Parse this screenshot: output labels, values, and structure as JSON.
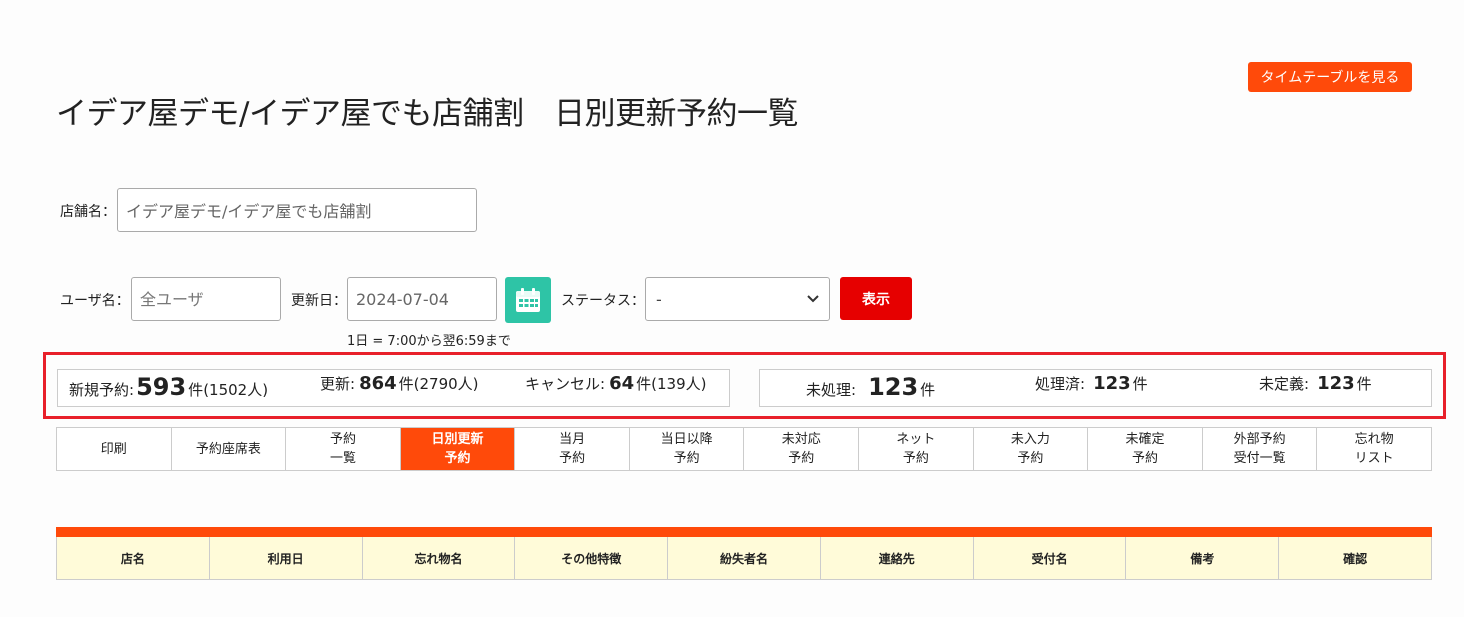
{
  "header": {
    "timetable_button": "タイムテーブルを見る",
    "title": "イデア屋デモ/イデア屋でも店舗割　日別更新予約一覧"
  },
  "filters": {
    "store_label": "店舗名：",
    "store_value": "イデア屋デモ/イデア屋でも店舗割",
    "user_label": "ユーザ名：",
    "user_placeholder": "全ユーザ",
    "date_label": "更新日：",
    "date_value": "2024-07-04",
    "status_label": "ステータス：",
    "status_selected": "-",
    "show_button": "表示",
    "date_hint": "1日 = 7:00から翌6:59まで"
  },
  "stats": {
    "new_label": "新規予約:",
    "new_count": "593",
    "new_unit": "件",
    "new_people": "(1502人)",
    "update_label": "更新:",
    "update_count": "864",
    "update_unit": "件",
    "update_people": "(2790人)",
    "cancel_label": "キャンセル:",
    "cancel_count": "64",
    "cancel_unit": "件",
    "cancel_people": "(139人)",
    "unprocessed_label": "未処理:",
    "unprocessed_count": "123",
    "unprocessed_unit": "件",
    "processed_label": "処理済:",
    "processed_count": "123",
    "processed_unit": "件",
    "undefined_label": "未定義:",
    "undefined_count": "123",
    "undefined_unit": "件"
  },
  "tabs": [
    {
      "label": "印刷"
    },
    {
      "label": "予約座席表"
    },
    {
      "label": "予約\n一覧"
    },
    {
      "label": "日別更新\n予約"
    },
    {
      "label": "当月\n予約"
    },
    {
      "label": "当日以降\n予約"
    },
    {
      "label": "未対応\n予約"
    },
    {
      "label": "ネット\n予約"
    },
    {
      "label": "未入力\n予約"
    },
    {
      "label": "未確定\n予約"
    },
    {
      "label": "外部予約\n受付一覧"
    },
    {
      "label": "忘れ物\nリスト"
    }
  ],
  "table": {
    "columns": [
      "店名",
      "利用日",
      "忘れ物名",
      "その他特徴",
      "紛失者名",
      "連絡先",
      "受付名",
      "備考",
      "確認"
    ]
  },
  "colors": {
    "accent": "#ff4a0a",
    "show_button": "#e60000",
    "calendar_button": "#2ec4a6",
    "highlight_frame": "#e8202a",
    "table_header_bg": "#fffbd9"
  }
}
